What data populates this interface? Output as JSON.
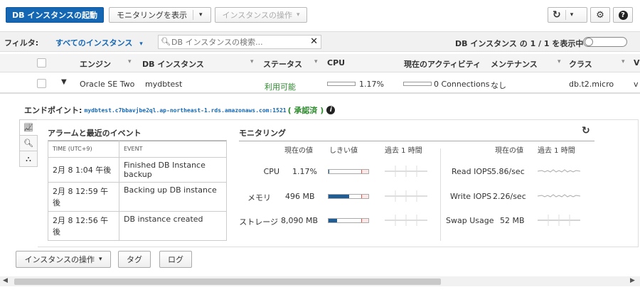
{
  "toolbar": {
    "launch_label": "DB インスタンスの起動",
    "monitoring_label": "モニタリングを表示",
    "instance_actions_label": "インスタンスの操作"
  },
  "filter": {
    "label": "フィルタ:",
    "selected": "すべてのインスタンス",
    "search_placeholder": "DB インスタンスの検索...",
    "count_text": "DB インスタンス の 1 / 1 を表示中"
  },
  "table": {
    "headers": [
      "エンジン",
      "DB インスタンス",
      "ステータス",
      "CPU",
      "現在のアクティビティ",
      "メンテナンス",
      "クラス"
    ],
    "row": {
      "engine": "Oracle SE Two",
      "instance": "mydbtest",
      "status": "利用可能",
      "cpu": "1.17%",
      "activity": "0 Connections",
      "maintenance": "なし",
      "class": "db.t2.micro",
      "extra": "v"
    }
  },
  "detail": {
    "endpoint_label": "エンドポイント:",
    "endpoint_value": "mydbtest.c7bbavjbe2ql.ap-northeast-1.rds.amazonaws.com:1521",
    "endpoint_status": "( 承認済 )",
    "alarms_title": "アラームと最近のイベント",
    "events_headers": [
      "TIME (UTC+9)",
      "EVENT"
    ],
    "events": [
      {
        "time": "2月 8 1:04 午後",
        "event": "Finished DB Instance backup"
      },
      {
        "time": "2月 8 12:59 午後",
        "event": "Backing up DB instance"
      },
      {
        "time": "2月 8 12:56 午後",
        "event": "DB instance created"
      }
    ],
    "monitoring_title": "モニタリング",
    "mon_headers": {
      "current": "現在の値",
      "threshold": "しきい値",
      "last_hour": "過去 1 時間"
    },
    "metrics_left": [
      {
        "label": "CPU",
        "value": "1.17%",
        "fill": 0.02
      },
      {
        "label": "メモリ",
        "value": "496 MB",
        "fill": 0.52
      },
      {
        "label": "ストレージ",
        "value": "8,090 MB",
        "fill": 0.22
      }
    ],
    "metrics_right": [
      {
        "label": "Read IOPS",
        "value": "5.86/sec"
      },
      {
        "label": "Write IOPS",
        "value": "2.26/sec"
      },
      {
        "label": "Swap Usage",
        "value": "52 MB"
      }
    ]
  },
  "bottom": {
    "actions_label": "インスタンスの操作",
    "tags_label": "タグ",
    "logs_label": "ログ"
  },
  "colors": {
    "primary": "#1567b4",
    "ok": "#2e8b2e",
    "bar_fill": "#1f5d94"
  }
}
